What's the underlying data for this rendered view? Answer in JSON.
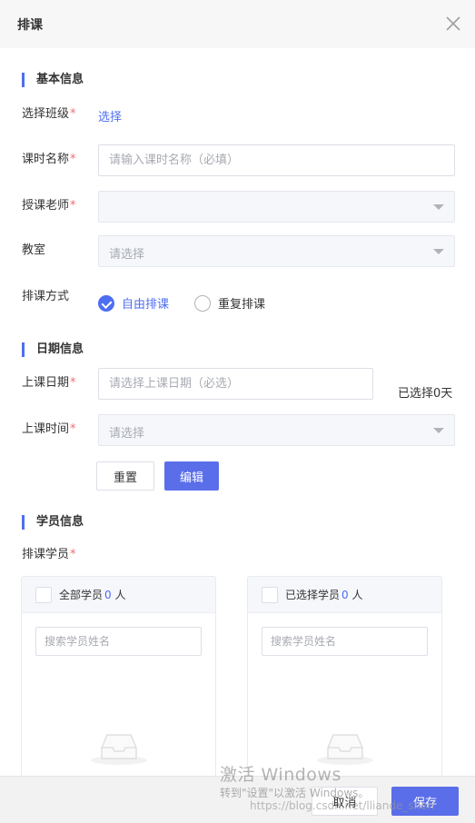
{
  "header": {
    "title": "排课"
  },
  "basic": {
    "section_title": "基本信息",
    "class_label": "选择班级",
    "class_link": "选择",
    "lesson_name_label": "课时名称",
    "lesson_name_placeholder": "请输入课时名称（必填）",
    "teacher_label": "授课老师",
    "room_label": "教室",
    "room_placeholder": "请选择",
    "mode_label": "排课方式",
    "mode_options": [
      "自由排课",
      "重复排课"
    ],
    "mode_selected": "自由排课"
  },
  "date": {
    "section_title": "日期信息",
    "date_label": "上课日期",
    "date_placeholder": "请选择上课日期（必选）",
    "selected_days": "已选择0天",
    "time_label": "上课时间",
    "time_placeholder": "请选择",
    "reset_label": "重置",
    "edit_label": "编辑"
  },
  "students": {
    "section_title": "学员信息",
    "label": "排课学员",
    "all_title": "全部学员",
    "all_count": "0",
    "selected_title": "已选择学员",
    "selected_count": "0",
    "unit": "人",
    "search_placeholder": "搜索学员姓名"
  },
  "footer": {
    "cancel_label": "取消",
    "save_label": "保存"
  },
  "watermark": {
    "line1": "激活 Windows",
    "line2": "转到\"设置\"以激活 Windows。",
    "line3": "https://blog.csdn.net/lliande_shen"
  },
  "required_mark": "*",
  "colors": {
    "accent": "#4e6ef2",
    "required": "#f56c6c"
  }
}
